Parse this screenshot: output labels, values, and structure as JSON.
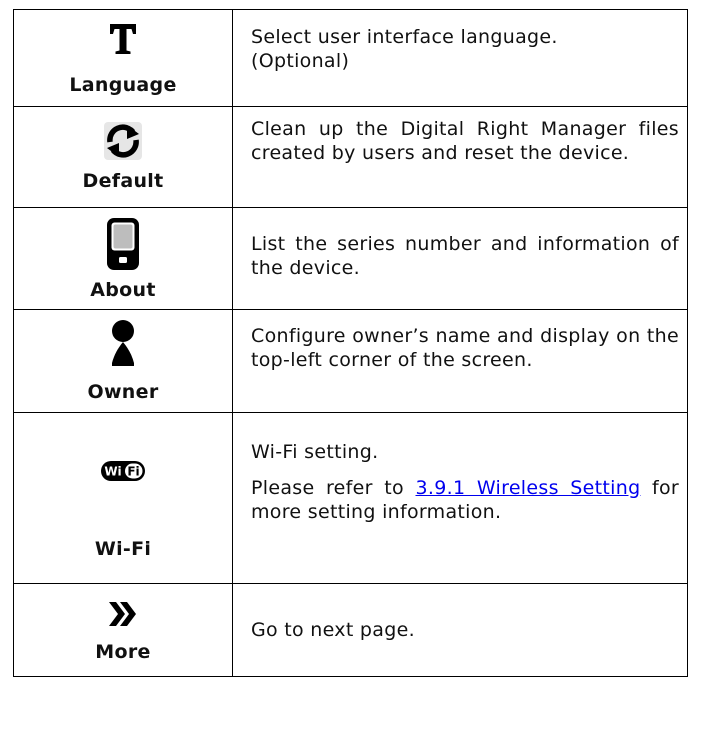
{
  "rows": [
    {
      "label": "Language",
      "icon": "language-t-icon",
      "description": [
        "Select user interface language.",
        "(Optional)"
      ]
    },
    {
      "label": "Default",
      "icon": "reset-arrows-icon",
      "description": "Clean up the Digital Right Manager files created by users and reset the device."
    },
    {
      "label": "About",
      "icon": "device-info-icon",
      "description": "List the series number and information of the device."
    },
    {
      "label": "Owner",
      "icon": "owner-person-icon",
      "description": "Configure owner’s name and display on the top-left corner of the screen."
    },
    {
      "label": "Wi-Fi",
      "icon": "wifi-badge-icon",
      "icon_text": "Wi Fi",
      "description": "Wi-Fi setting.",
      "note_prefix": "Please refer to",
      "link": "3.9.1 Wireless Setting",
      "note_suffix": "for more setting information."
    },
    {
      "label": "More",
      "icon": "double-chevron-right-icon",
      "description": "Go to next page."
    }
  ]
}
